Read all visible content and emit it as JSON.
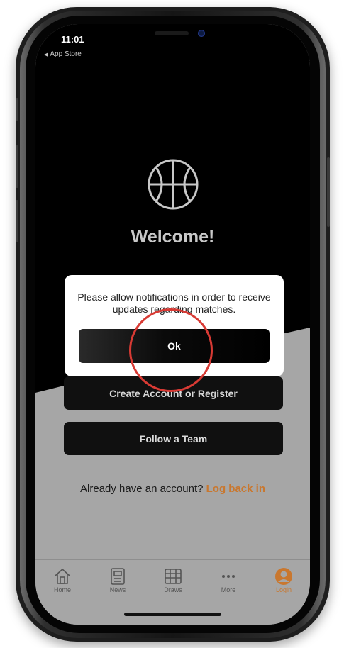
{
  "status_bar": {
    "time": "11:01",
    "back_label": "App Store"
  },
  "welcome": {
    "title": "Welcome!"
  },
  "dialog": {
    "message": "Please allow notifications in order to receive updates regarding matches.",
    "ok_label": "Ok"
  },
  "buttons": {
    "create_account": "Create Account or Register",
    "follow_team": "Follow a Team"
  },
  "login_prompt": {
    "text": "Already have an account?",
    "link": "Log back in"
  },
  "tabbar": {
    "items": [
      {
        "label": "Home",
        "icon": "home-icon"
      },
      {
        "label": "News",
        "icon": "news-icon"
      },
      {
        "label": "Draws",
        "icon": "draws-icon"
      },
      {
        "label": "More",
        "icon": "more-icon"
      },
      {
        "label": "Login",
        "icon": "login-icon",
        "active": true
      }
    ]
  },
  "colors": {
    "accent": "#c9772e",
    "highlight_circle": "#d83a34",
    "background_light": "#a6a6a6",
    "background_dark": "#000000"
  }
}
